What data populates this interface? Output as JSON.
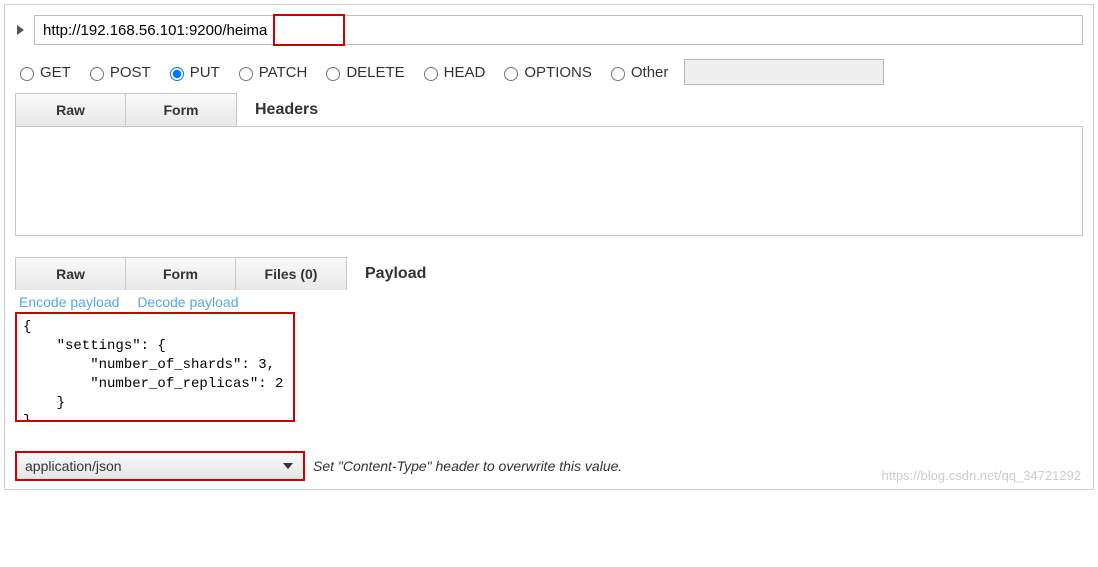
{
  "url": {
    "value": "http://192.168.56.101:9200/heima",
    "highlight_segment": "heima"
  },
  "methods": {
    "options": [
      "GET",
      "POST",
      "PUT",
      "PATCH",
      "DELETE",
      "HEAD",
      "OPTIONS",
      "Other"
    ],
    "selected": "PUT",
    "other_value": ""
  },
  "headers": {
    "title": "Headers",
    "tabs": [
      "Raw",
      "Form"
    ],
    "active_tab": "Raw",
    "content": ""
  },
  "payload": {
    "title": "Payload",
    "tabs": [
      "Raw",
      "Form",
      "Files (0)"
    ],
    "active_tab": "Raw",
    "encode_link": "Encode payload",
    "decode_link": "Decode payload",
    "body": "{\n    \"settings\": {\n        \"number_of_shards\": 3,\n        \"number_of_replicas\": 2\n    }\n}"
  },
  "content_type": {
    "selected": "application/json",
    "caption": "Set \"Content-Type\" header to overwrite this value."
  },
  "watermark": "https://blog.csdn.net/qq_34721292"
}
